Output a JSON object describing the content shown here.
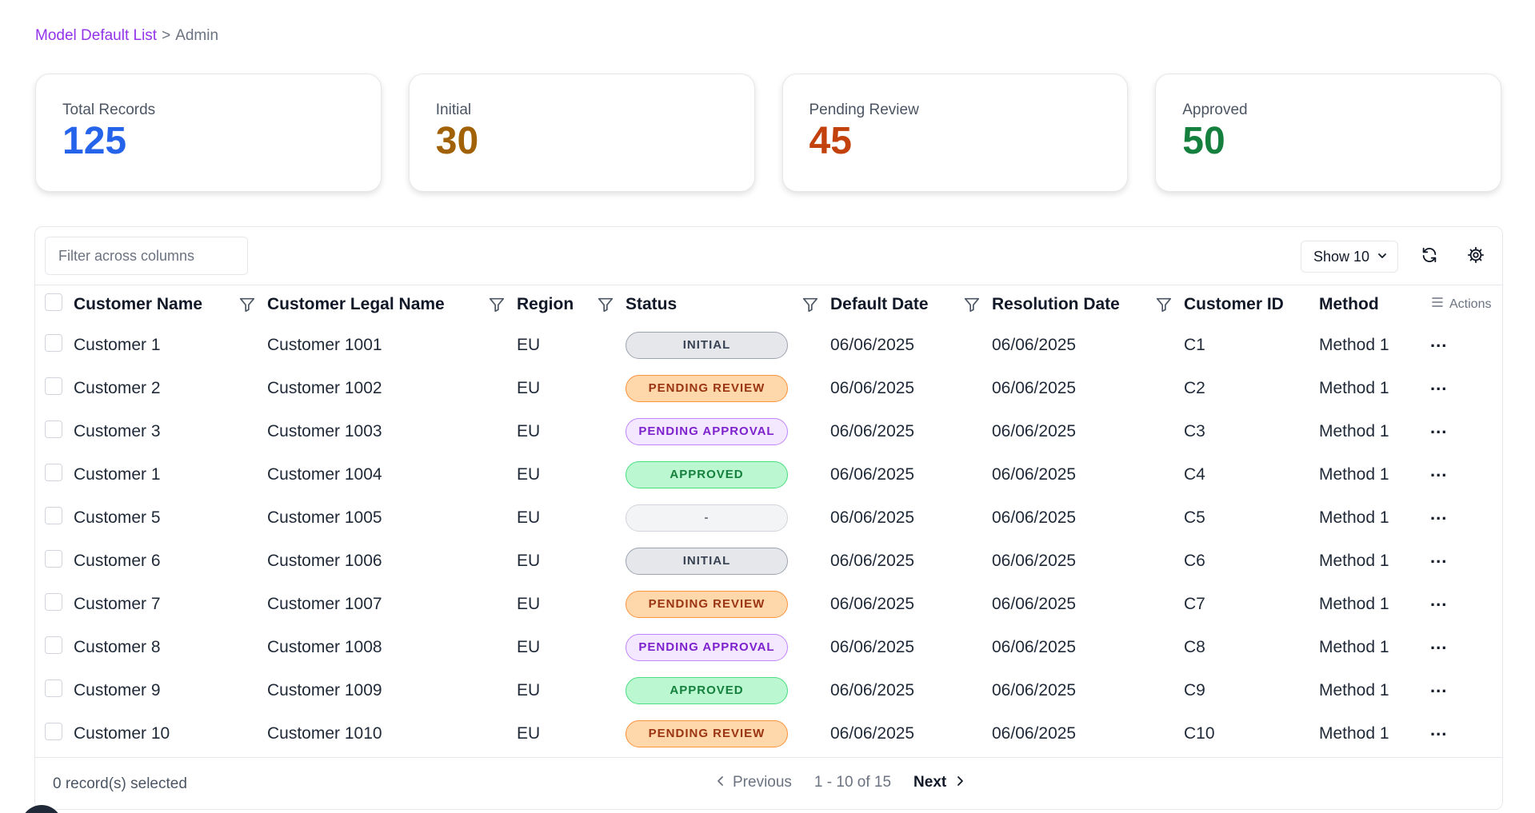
{
  "breadcrumb": {
    "parent": "Model Default List",
    "separator": ">",
    "current": "Admin"
  },
  "stats": [
    {
      "label": "Total Records",
      "value": "125",
      "color": "#2563eb"
    },
    {
      "label": "Initial",
      "value": "30",
      "color": "#a16207"
    },
    {
      "label": "Pending Review",
      "value": "45",
      "color": "#c2410c"
    },
    {
      "label": "Approved",
      "value": "50",
      "color": "#15803d"
    }
  ],
  "toolbar": {
    "filter_placeholder": "Filter across columns",
    "show_label": "Show 10",
    "refresh_icon": "refresh-icon",
    "settings_icon": "gear-icon"
  },
  "columns": {
    "customer_name": "Customer Name",
    "legal_name": "Customer Legal Name",
    "region": "Region",
    "status": "Status",
    "default_date": "Default Date",
    "resolution_date": "Resolution Date",
    "customer_id": "Customer ID",
    "method": "Method",
    "actions": "Actions"
  },
  "rows": [
    {
      "name": "Customer 1",
      "legal": "Customer 1001",
      "region": "EU",
      "status": "INITIAL",
      "status_class": "st-initial",
      "default_date": "06/06/2025",
      "resolution_date": "06/06/2025",
      "id": "C1",
      "method": "Method 1"
    },
    {
      "name": "Customer 2",
      "legal": "Customer 1002",
      "region": "EU",
      "status": "PENDING REVIEW",
      "status_class": "st-pending-review",
      "default_date": "06/06/2025",
      "resolution_date": "06/06/2025",
      "id": "C2",
      "method": "Method 1"
    },
    {
      "name": "Customer 3",
      "legal": "Customer 1003",
      "region": "EU",
      "status": "PENDING APPROVAL",
      "status_class": "st-pending-approval",
      "default_date": "06/06/2025",
      "resolution_date": "06/06/2025",
      "id": "C3",
      "method": "Method 1"
    },
    {
      "name": "Customer 1",
      "legal": "Customer 1004",
      "region": "EU",
      "status": "APPROVED",
      "status_class": "st-approved",
      "default_date": "06/06/2025",
      "resolution_date": "06/06/2025",
      "id": "C4",
      "method": "Method 1"
    },
    {
      "name": "Customer 5",
      "legal": "Customer 1005",
      "region": "EU",
      "status": "-",
      "status_class": "st-none",
      "default_date": "06/06/2025",
      "resolution_date": "06/06/2025",
      "id": "C5",
      "method": "Method 1"
    },
    {
      "name": "Customer 6",
      "legal": "Customer 1006",
      "region": "EU",
      "status": "INITIAL",
      "status_class": "st-initial",
      "default_date": "06/06/2025",
      "resolution_date": "06/06/2025",
      "id": "C6",
      "method": "Method 1"
    },
    {
      "name": "Customer 7",
      "legal": "Customer 1007",
      "region": "EU",
      "status": "PENDING REVIEW",
      "status_class": "st-pending-review",
      "default_date": "06/06/2025",
      "resolution_date": "06/06/2025",
      "id": "C7",
      "method": "Method 1"
    },
    {
      "name": "Customer 8",
      "legal": "Customer 1008",
      "region": "EU",
      "status": "PENDING APPROVAL",
      "status_class": "st-pending-approval",
      "default_date": "06/06/2025",
      "resolution_date": "06/06/2025",
      "id": "C8",
      "method": "Method 1"
    },
    {
      "name": "Customer 9",
      "legal": "Customer 1009",
      "region": "EU",
      "status": "APPROVED",
      "status_class": "st-approved",
      "default_date": "06/06/2025",
      "resolution_date": "06/06/2025",
      "id": "C9",
      "method": "Method 1"
    },
    {
      "name": "Customer 10",
      "legal": "Customer 1010",
      "region": "EU",
      "status": "PENDING REVIEW",
      "status_class": "st-pending-review",
      "default_date": "06/06/2025",
      "resolution_date": "06/06/2025",
      "id": "C10",
      "method": "Method 1"
    }
  ],
  "row_actions": "...",
  "footer": {
    "selected": "0 record(s) selected",
    "previous": "Previous",
    "range": "1 - 10 of 15",
    "next": "Next"
  }
}
